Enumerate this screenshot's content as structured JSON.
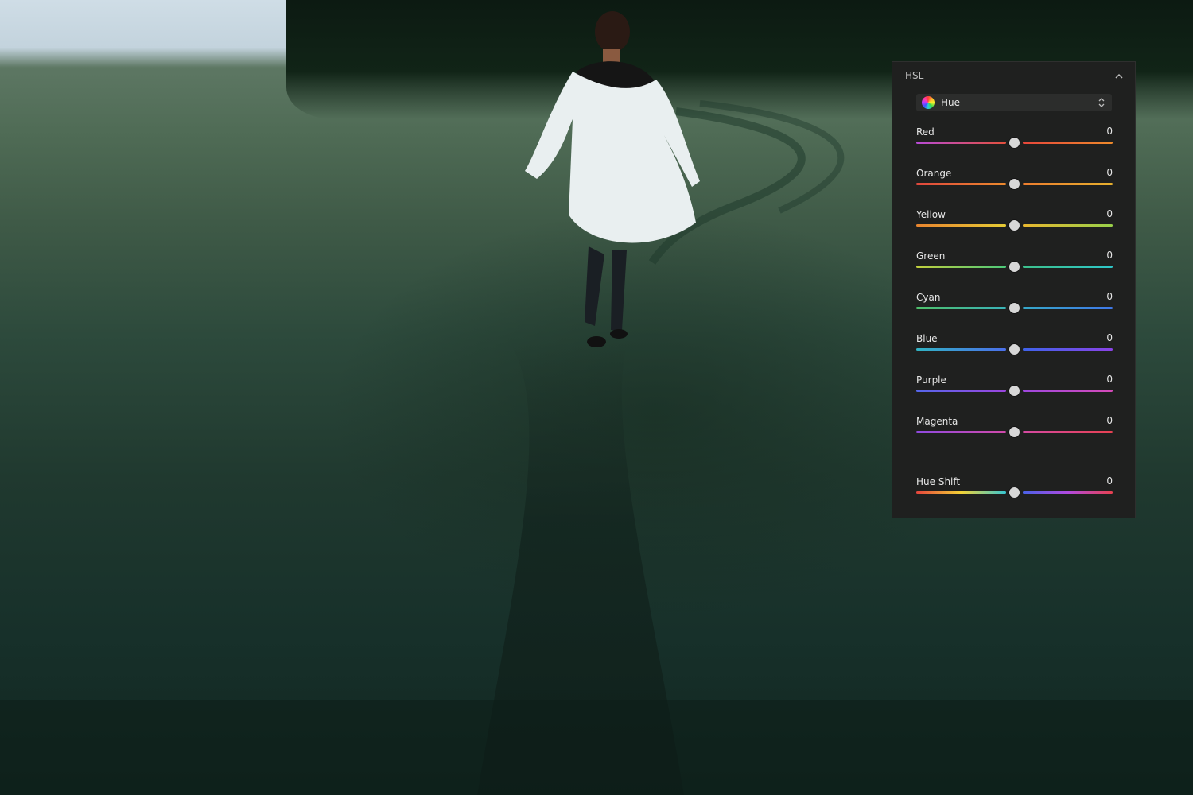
{
  "panel": {
    "title": "HSL",
    "collapse_icon": "chevron-up-icon",
    "mode_select": {
      "icon": "color-wheel-icon",
      "value": "Hue",
      "indicator_icon": "updown-chevron-icon"
    },
    "sliders": [
      {
        "label": "Red",
        "value": "0",
        "colors": [
          "#b74bd6",
          "#e4503c",
          "#e8473b",
          "#ee8a2b"
        ]
      },
      {
        "label": "Orange",
        "value": "0",
        "colors": [
          "#e0473d",
          "#ec8a2d",
          "#ec7d2e",
          "#e7b02e"
        ]
      },
      {
        "label": "Yellow",
        "value": "0",
        "colors": [
          "#e9852f",
          "#e6cc35",
          "#e8b72f",
          "#99d14a"
        ]
      },
      {
        "label": "Green",
        "value": "0",
        "colors": [
          "#c2d03d",
          "#4cc97a",
          "#3dc08c",
          "#2ec7c9"
        ]
      },
      {
        "label": "Cyan",
        "value": "0",
        "colors": [
          "#4ec06a",
          "#3ab3b8",
          "#36a8c8",
          "#3f78e8"
        ]
      },
      {
        "label": "Blue",
        "value": "0",
        "colors": [
          "#31b3c3",
          "#4b6fea",
          "#3f63ea",
          "#8a43e6"
        ]
      },
      {
        "label": "Purple",
        "value": "0",
        "colors": [
          "#5566ea",
          "#9b45de",
          "#9e48de",
          "#d54ab8"
        ]
      },
      {
        "label": "Magenta",
        "value": "0",
        "colors": [
          "#8f4ae0",
          "#d14aaa",
          "#d54aa2",
          "#e84152"
        ]
      },
      {
        "label": "Hue Shift",
        "value": "0",
        "colors": [
          "#e5443c",
          "#f3d236",
          "#36c6d2",
          "#4a62e8",
          "#b04ae0",
          "#e8414f"
        ]
      }
    ]
  }
}
